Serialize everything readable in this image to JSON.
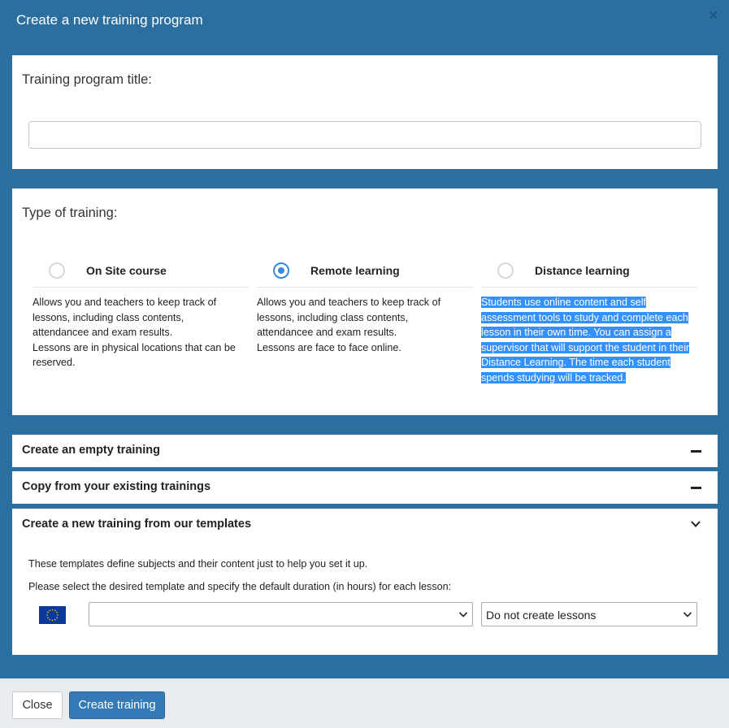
{
  "modal": {
    "title": "Create a new training program",
    "close_icon": "close-icon"
  },
  "title_section": {
    "label": "Training program title:",
    "input_value": ""
  },
  "type_section": {
    "label": "Type of training:",
    "selected": "remote",
    "options": [
      {
        "id": "onsite",
        "label": "On Site course",
        "checked": false,
        "description": [
          "Allows you and teachers to keep track of",
          "lessons, including class contents,",
          "attendancee and exam results.",
          "Lessons are in physical locations that can be",
          "reserved."
        ]
      },
      {
        "id": "remote",
        "label": "Remote learning",
        "checked": true,
        "description": [
          "Allows you and teachers to keep track of",
          "lessons, including class contents,",
          "attendancee and exam results.",
          "Lessons are face to face online."
        ]
      },
      {
        "id": "distance",
        "label": "Distance learning",
        "checked": false,
        "description": [
          "Students use online content and self",
          "assessment tools to study and complete each",
          "lesson in their own time. You can assign a",
          "supervisor that will support the student in their",
          "Distance Learning. The time each student",
          "spends studying will be tracked."
        ]
      }
    ]
  },
  "accordion": {
    "empty": {
      "label": "Create an empty training",
      "icon": "minus-icon"
    },
    "copy": {
      "label": "Copy from your existing trainings",
      "icon": "minus-icon"
    },
    "templates": {
      "label": "Create a new training from our templates",
      "icon": "chevron-down-icon",
      "line1": "These templates define subjects and their content just to help you set it up.",
      "line2": "Please select the desired template and specify the default duration (in hours) for each lesson:",
      "flag_icon": "eu-flag-icon",
      "template_select_value": "",
      "duration_select_value": "Do not create lessons"
    }
  },
  "footer": {
    "close_label": "Close",
    "create_label": "Create training"
  },
  "colors": {
    "backdrop": "#2a6f9f",
    "primary_button": "#337ab7",
    "radio_active": "#3a89d6",
    "text_selection": "#3390ff"
  }
}
